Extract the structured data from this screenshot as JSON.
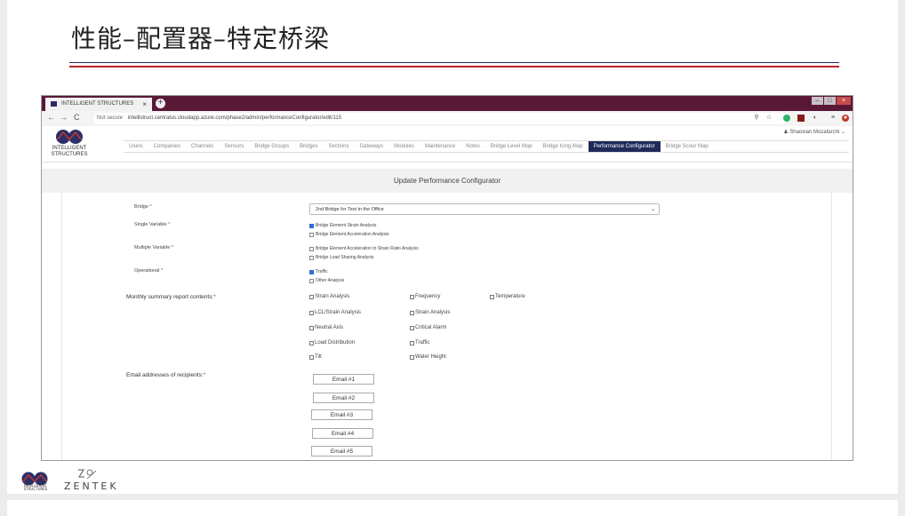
{
  "slide": {
    "title": "性能–配置器–特定桥梁"
  },
  "browser": {
    "tab_title": "INTELLIGENT STRUCTURES",
    "tab_close": "×",
    "new_tab": "+",
    "back": "←",
    "forward": "→",
    "reload": "C",
    "security": "Not secure",
    "url": "intellistruct.centralus.cloudapp.azure.com/phase2/admin/performanceConfigurator/edit/115",
    "user": "Shaoxian Mozafarchi"
  },
  "app": {
    "logo_text": "INTELLIGENT STRUCTURES",
    "menu": [
      "Users",
      "Companies",
      "Channels",
      "Sensors",
      "Bridge Groups",
      "Bridges",
      "Sections",
      "Gateways",
      "Modules",
      "Maintenance",
      "Notes",
      "Bridge Level Map",
      "Bridge Icing Map",
      "Performance Configurator",
      "Bridge Scour Map"
    ],
    "active_menu": "Performance Configurator",
    "panel_title": "Update Performance Configurator"
  },
  "form": {
    "bridge_label": "Bridge",
    "bridge_value": "2nd Bridge for Test in the Office",
    "single_label": "Single Variable",
    "single_options": [
      {
        "label": "Bridge Element Strain Analysis",
        "checked": true
      },
      {
        "label": "Bridge Element Acceleration Analysis",
        "checked": false
      }
    ],
    "multiple_label": "Multiple Variable",
    "multiple_options": [
      {
        "label": "Bridge Element Acceleration to Strain Ratio Analysis",
        "checked": false
      },
      {
        "label": "Bridge Load Sharing Analysis",
        "checked": false
      }
    ],
    "operational_label": "Operational",
    "operational_options": [
      {
        "label": "Traffic",
        "checked": true
      },
      {
        "label": "Other Analysis",
        "checked": false
      }
    ],
    "monthly_label": "Monthly summary report contents:",
    "monthly_options": [
      "Strain Analysis",
      "Frequency",
      "Temperature",
      "LCL/Strain Analysis",
      "Strain Analysis",
      "Neutral Axis",
      "Critical Alarm",
      "Load Distribution",
      "Traffic",
      "Tilt",
      "Water Height"
    ],
    "email_label": "Email addresses of recipients:",
    "emails": [
      "Email #1",
      "Email #2",
      "Email #3",
      "Email #4",
      "Email #5"
    ],
    "required_mark": "*"
  },
  "footer": {
    "brand1": "INTELLIGENT STRUCTURES",
    "brand2": "ZENTEK"
  },
  "colors": {
    "accent_navy": "#1f2a5a",
    "accent_red": "#b8252a",
    "tab_bar": "#5a1837"
  }
}
